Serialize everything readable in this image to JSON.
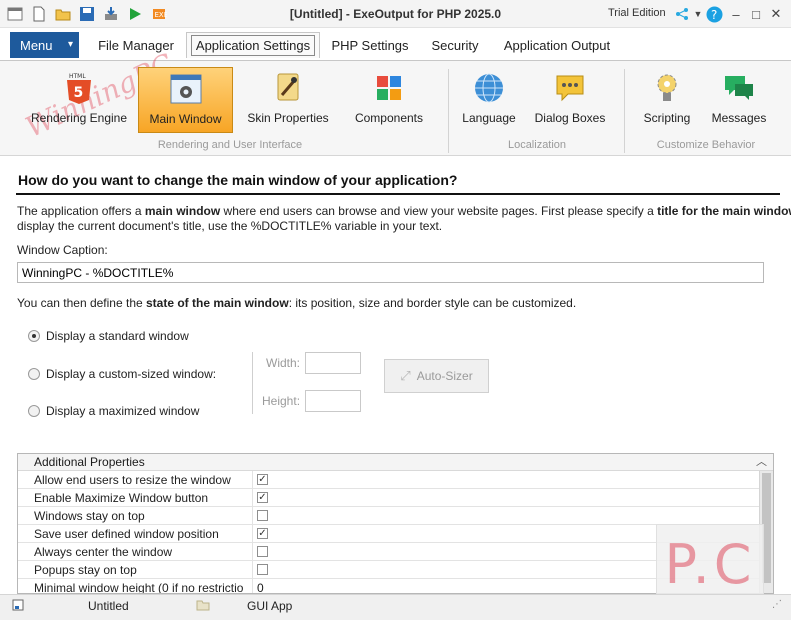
{
  "title": "[Untitled] - ExeOutput for PHP 2025.0",
  "trial_label": "Trial Edition",
  "menu_label": "Menu",
  "tabs": [
    {
      "label": "File Manager"
    },
    {
      "label": "Application Settings"
    },
    {
      "label": "PHP Settings"
    },
    {
      "label": "Security"
    },
    {
      "label": "Application Output"
    }
  ],
  "ribbon": {
    "buttons": [
      {
        "label": "Rendering Engine",
        "icon": "html5-icon"
      },
      {
        "label": "Main Window",
        "icon": "window-gear-icon"
      },
      {
        "label": "Skin Properties",
        "icon": "brush-icon"
      },
      {
        "label": "Components",
        "icon": "puzzle-icon"
      },
      {
        "label": "Language",
        "icon": "globe-icon"
      },
      {
        "label": "Dialog Boxes",
        "icon": "speech-bubble-icon"
      },
      {
        "label": "Scripting",
        "icon": "bulb-gear-icon"
      },
      {
        "label": "Messages",
        "icon": "messages-icon"
      }
    ],
    "groups": [
      "Rendering and User Interface",
      "Localization",
      "Customize Behavior"
    ]
  },
  "main": {
    "heading": "How do you want to change the main window of your application?",
    "intro_1": "The application offers a ",
    "intro_b1": "main window",
    "intro_2": " where end users can browse and view your website pages. First please specify a ",
    "intro_b2": "title for the main window",
    "intro_3": ";",
    "intro_line2": "display the current document's title, use the %DOCTITLE% variable in your text.",
    "caption_label": "Window Caption:",
    "caption_value": "WinningPC - %DOCTITLE%",
    "state_1": "You can then define the ",
    "state_b": "state of the main window",
    "state_2": ": its position, size and border style can be customized.",
    "radios": [
      {
        "label": "Display a standard window",
        "checked": true
      },
      {
        "label": "Display a custom-sized window:",
        "checked": false
      },
      {
        "label": "Display a maximized window",
        "checked": false
      }
    ],
    "width_label": "Width:",
    "height_label": "Height:",
    "autosizer_label": "Auto-Sizer"
  },
  "properties": {
    "header": "Additional Properties",
    "rows": [
      {
        "name": "Allow end users to resize the window",
        "type": "checkbox",
        "checked": true
      },
      {
        "name": "Enable Maximize Window button",
        "type": "checkbox",
        "checked": true
      },
      {
        "name": "Windows stay on top",
        "type": "checkbox",
        "checked": false
      },
      {
        "name": "Save user defined window position",
        "type": "checkbox",
        "checked": true
      },
      {
        "name": "Always center the window",
        "type": "checkbox",
        "checked": false
      },
      {
        "name": "Popups stay on top",
        "type": "checkbox",
        "checked": false
      },
      {
        "name": "Minimal window height (0 if no restrictio",
        "type": "number",
        "value": "0"
      }
    ]
  },
  "status": {
    "doc": "Untitled",
    "mode": "GUI App"
  },
  "colors": {
    "menu_bg": "#1e5a9c",
    "selected_ribbon": "#f7a525",
    "help_icon": "#1ba1e2"
  }
}
